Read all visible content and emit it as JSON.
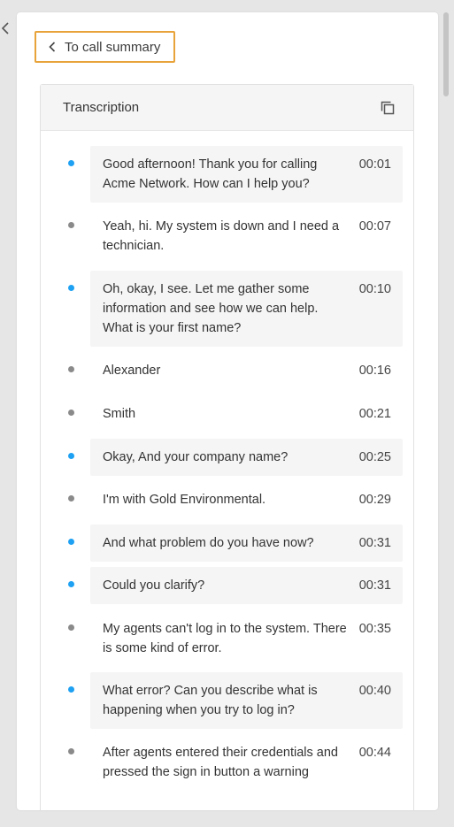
{
  "nav": {
    "back_label": "To call summary"
  },
  "transcription": {
    "title": "Transcription",
    "messages": [
      {
        "speaker": "agent",
        "text": "Good afternoon! Thank you for calling Acme Network. How can I help you?",
        "time": "00:01"
      },
      {
        "speaker": "caller",
        "text": "Yeah, hi. My system is down and I need a technician.",
        "time": "00:07"
      },
      {
        "speaker": "agent",
        "text": "Oh, okay, I see. Let me gather some information and see how we can help. What is your first name?",
        "time": "00:10"
      },
      {
        "speaker": "caller",
        "text": "Alexander",
        "time": "00:16"
      },
      {
        "speaker": "caller",
        "text": "Smith",
        "time": "00:21"
      },
      {
        "speaker": "agent",
        "text": "Okay, And your company name?",
        "time": "00:25"
      },
      {
        "speaker": "caller",
        "text": "I'm with Gold Environmental.",
        "time": "00:29"
      },
      {
        "speaker": "agent",
        "text": "And what problem do you have now?",
        "time": "00:31"
      },
      {
        "speaker": "agent",
        "text": "Could you clarify?",
        "time": "00:31"
      },
      {
        "speaker": "caller",
        "text": "My agents can't log in to the system. There is some kind of error.",
        "time": "00:35"
      },
      {
        "speaker": "agent",
        "text": "What error? Can you describe what is happening when you try to log in?",
        "time": "00:40"
      },
      {
        "speaker": "caller",
        "text": "After agents entered their credentials and pressed the sign in button a warning",
        "time": "00:44"
      }
    ]
  },
  "colors": {
    "accent_outline": "#e8a33a",
    "agent_dot": "#1ea1f2",
    "caller_dot": "#8a8a8a",
    "agent_bubble": "#f5f5f5"
  },
  "icons": {
    "collapse": "chevron-left-icon",
    "back": "chevron-left-icon",
    "copy": "copy-icon"
  }
}
